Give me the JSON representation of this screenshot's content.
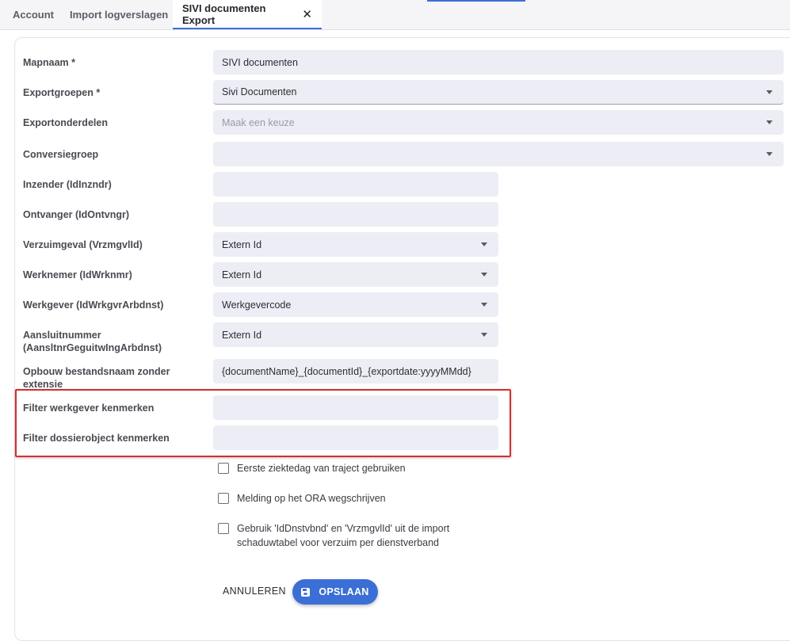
{
  "tabs": [
    {
      "label": "Account"
    },
    {
      "label": "Import logverslagen"
    },
    {
      "label": "SIVI documenten Export",
      "close": "✕"
    }
  ],
  "form": {
    "mapnaam": {
      "label": "Mapnaam",
      "required": "*",
      "value": "SIVI documenten"
    },
    "exportgroepen": {
      "label": "Exportgroepen",
      "required": "*",
      "value": "Sivi Documenten"
    },
    "exportonderdelen": {
      "label": "Exportonderdelen",
      "placeholder": "Maak een keuze"
    },
    "conversiegroep": {
      "label": "Conversiegroep",
      "value": ""
    },
    "inzender": {
      "label": "Inzender (IdInzndr)",
      "value": ""
    },
    "ontvanger": {
      "label": "Ontvanger (IdOntvngr)",
      "value": ""
    },
    "verzuimgeval": {
      "label": "Verzuimgeval (VrzmgvlId)",
      "value": "Extern Id"
    },
    "werknemer": {
      "label": "Werknemer (IdWrknmr)",
      "value": "Extern Id"
    },
    "werkgever": {
      "label": "Werkgever (IdWrkgvrArbdnst)",
      "value": "Werkgevercode"
    },
    "aansluitnummer": {
      "label_line1": "Aansluitnummer",
      "label_line2": "(AansltnrGeguitwIngArbdnst)",
      "value": "Extern Id"
    },
    "opbouw": {
      "label_line1": "Opbouw bestandsnaam zonder",
      "label_line2": "extensie",
      "value": "{documentName}_{documentId}_{exportdate:yyyyMMdd}"
    },
    "filter_werkgever": {
      "label": "Filter werkgever kenmerken",
      "value": ""
    },
    "filter_dossierobject": {
      "label": "Filter dossierobject kenmerken",
      "value": ""
    }
  },
  "checkboxes": [
    {
      "label": "Eerste ziektedag van traject gebruiken",
      "checked": false
    },
    {
      "label": "Melding op het ORA wegschrijven",
      "checked": false
    },
    {
      "label_line1": "Gebruik 'IdDnstvbnd' en 'VrzmgvlId' uit de import",
      "label_line2": "schaduwtabel voor verzuim per dienstverband",
      "checked": false
    }
  ],
  "actions": {
    "cancel": "ANNULEREN",
    "save": "OPSLAAN"
  },
  "colors": {
    "accent": "#3b6fd6",
    "highlight": "#d32f2f",
    "field_bg": "#ededf5"
  }
}
